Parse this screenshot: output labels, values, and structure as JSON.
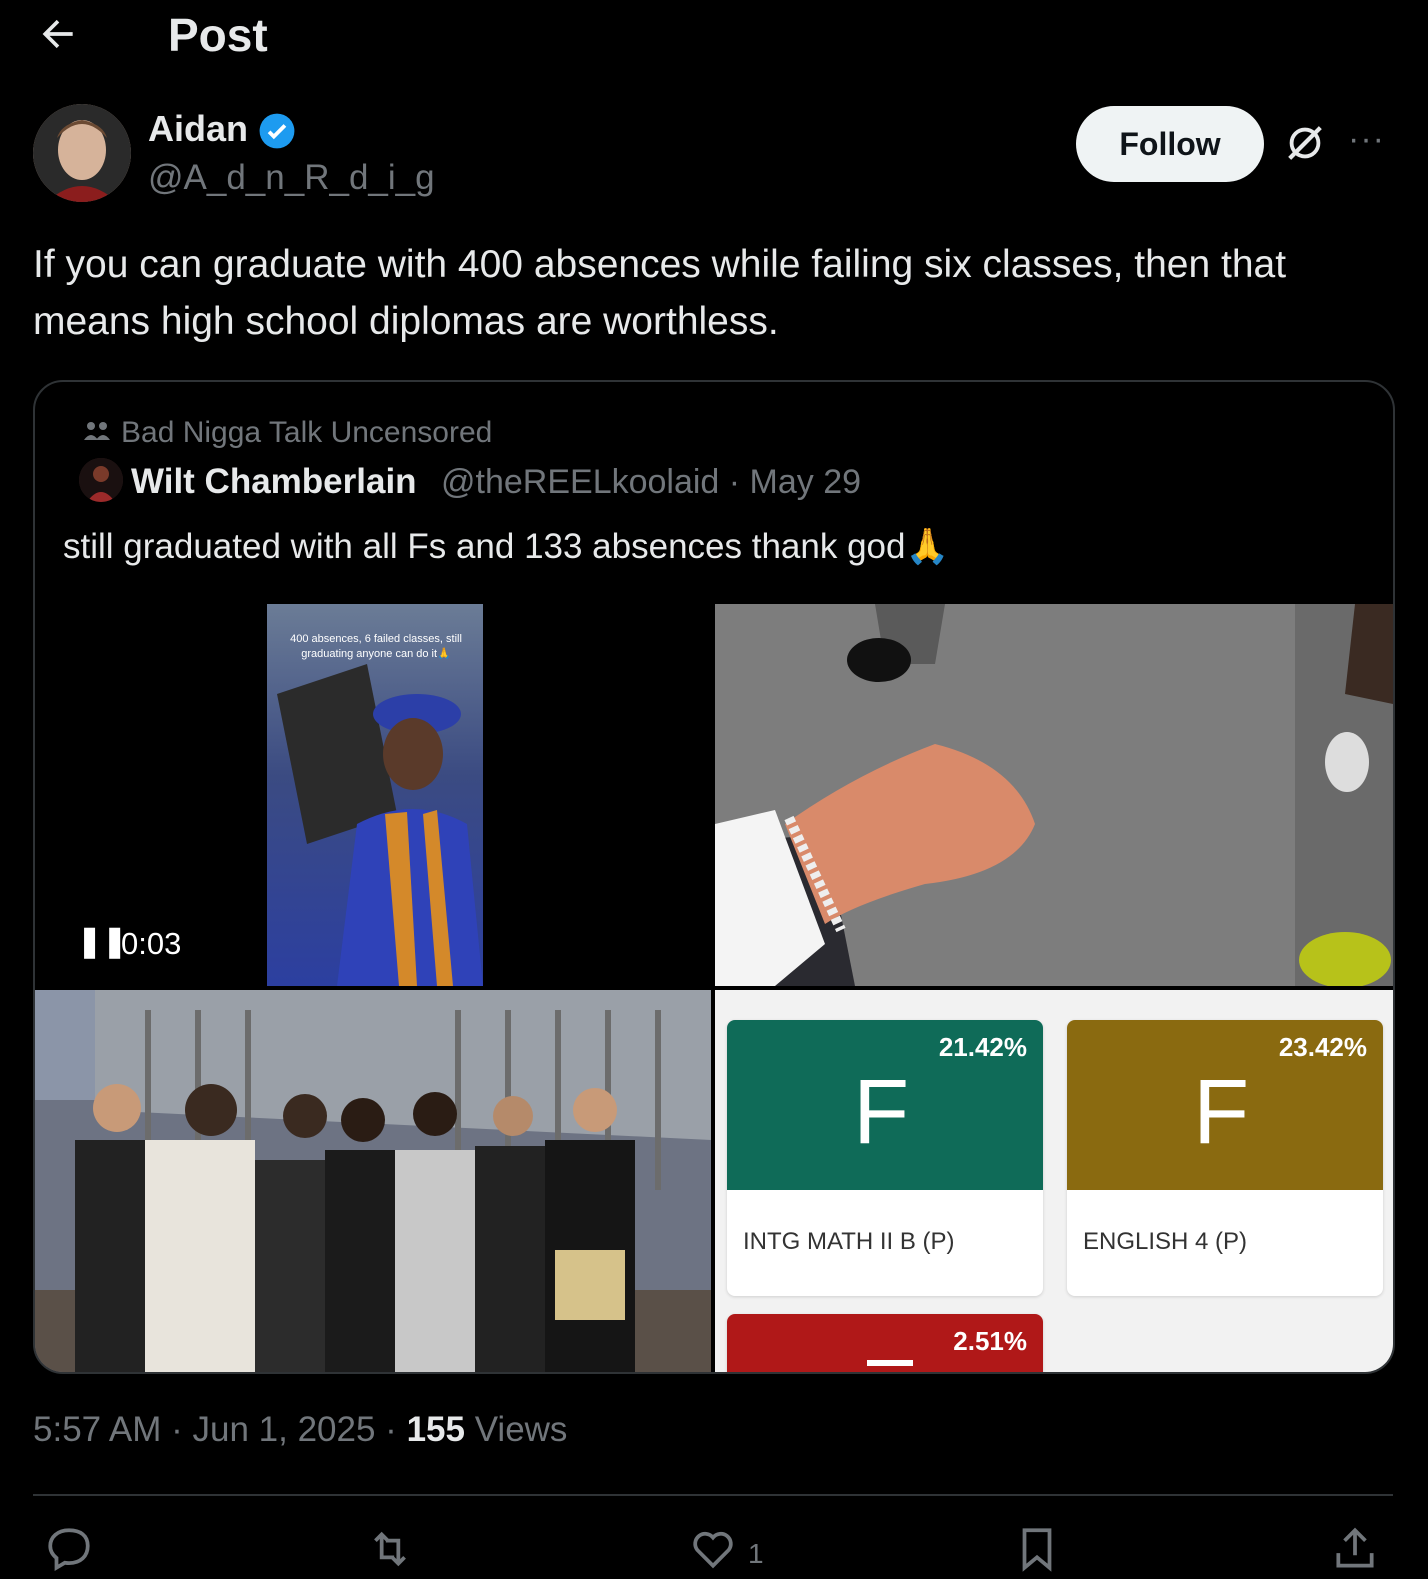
{
  "header": {
    "back_icon": "arrow-left-icon",
    "title": "Post"
  },
  "author": {
    "name": "Aidan",
    "handle": "@A_d_n_R_d_i_g",
    "verified": true
  },
  "follow_label": "Follow",
  "post_text": "If you can graduate with 400 absences while failing six classes, then that means high school diplomas are worthless.",
  "quote": {
    "community": "Bad Nigga Talk Uncensored",
    "name": "Wilt Chamberlain",
    "handle": "@theREELkoolaid",
    "date": "May 29",
    "meta": "@theREELkoolaid · May 29",
    "text": "still graduated with all Fs and 133 absences thank god🙏",
    "video": {
      "caption": "400 absences, 6 failed classes, still graduating anyone can do it🙏",
      "time": "0:03"
    },
    "grades": [
      {
        "percent": "21.42%",
        "letter": "F",
        "course": "INTG MATH II B (P)",
        "color": "#0f6b58"
      },
      {
        "percent": "23.42%",
        "letter": "F",
        "course": "ENGLISH 4 (P)",
        "color": "#8a6a10"
      },
      {
        "percent": "2.51%",
        "letter": "F",
        "course": "",
        "color": "#b01818"
      }
    ]
  },
  "footer": {
    "time": "5:57 AM",
    "date": "Jun 1, 2025",
    "views_count": "155",
    "views_label": "Views",
    "time_date": "5:57 AM · Jun 1, 2025 · "
  },
  "actions": {
    "like_count": "1"
  },
  "colors": {
    "background": "#000000",
    "text": "#e7e9ea",
    "muted": "#71767b",
    "verified_blue": "#1d9bf0"
  }
}
